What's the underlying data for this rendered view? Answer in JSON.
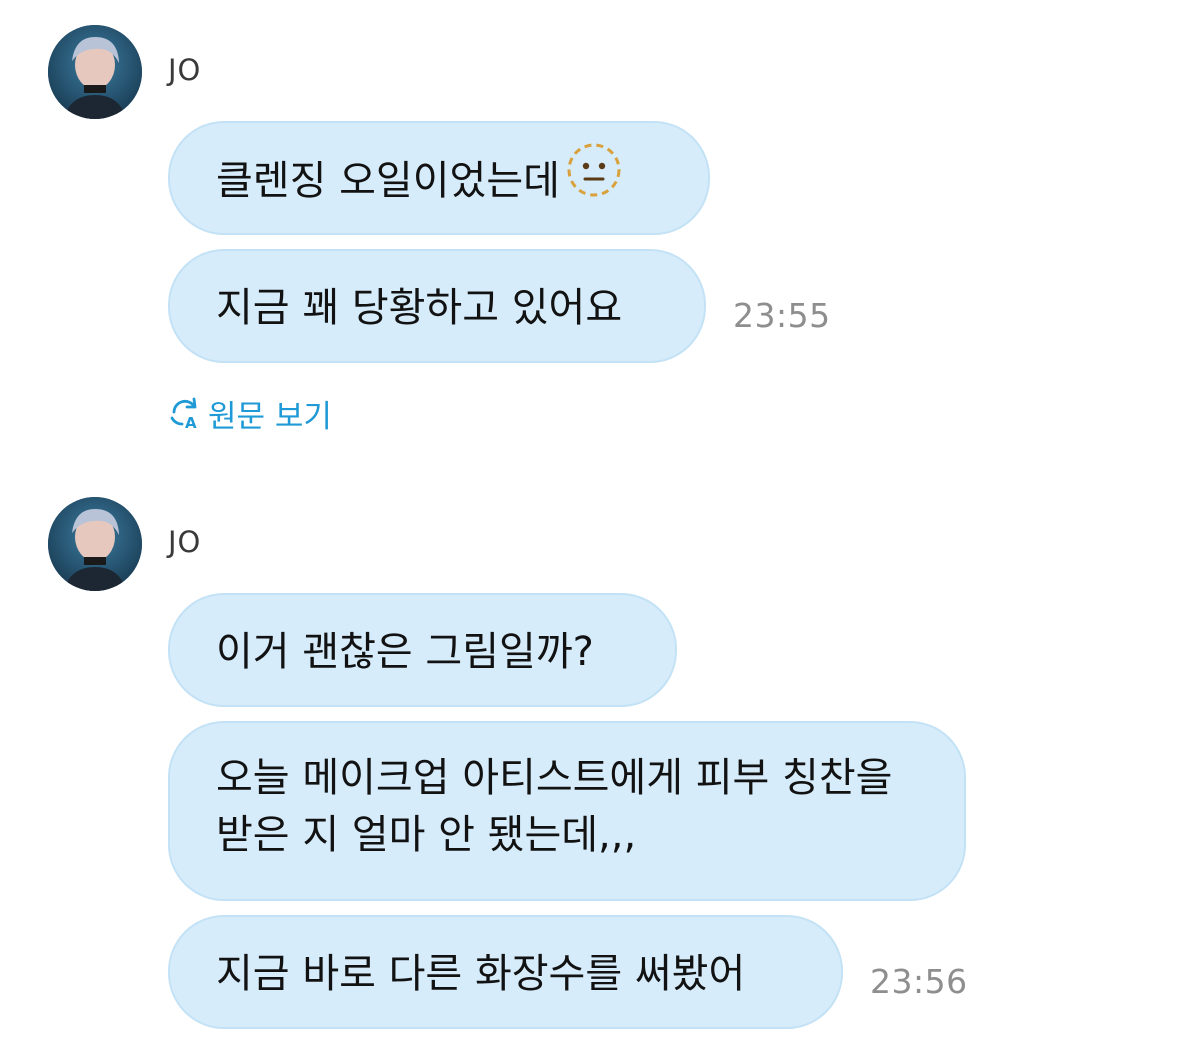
{
  "groups": [
    {
      "sender": "JO",
      "messages": [
        "클렌징 오일이었는데",
        "지금 꽤 당황하고 있어요"
      ],
      "time": "23:55",
      "translate_label": "원문 보기"
    },
    {
      "sender": "JO",
      "messages": [
        "이거 괜찮은 그림일까?",
        "오늘 메이크업 아티스트에게 피부 칭찬을 받은 지 얼마 안 됐는데,,,",
        "지금 바로 다른 화장수를 써봤어"
      ],
      "time": "23:56"
    }
  ],
  "icons": {
    "emoji": "neutral-face-dotted-icon",
    "translate": "translate-refresh-icon"
  },
  "colors": {
    "bubble": "#d6ecfb",
    "bubble_border": "#c4e2f6",
    "link": "#1f9ad6",
    "time": "#8e8e8e"
  }
}
